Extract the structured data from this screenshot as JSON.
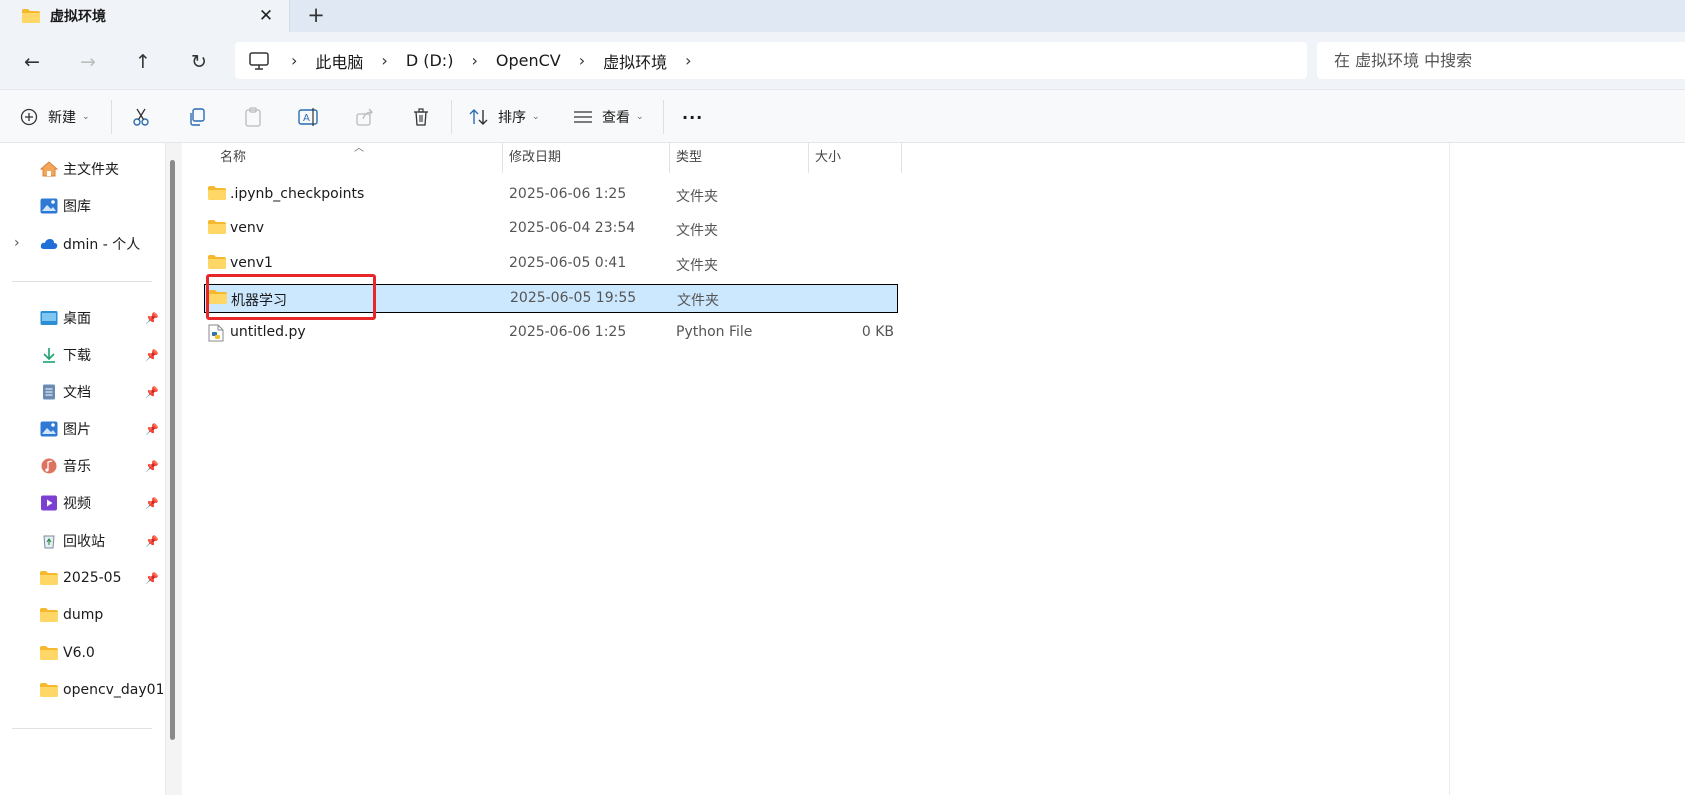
{
  "tab": {
    "title": "虚拟环境",
    "close": "✕",
    "add": "+"
  },
  "nav": {
    "back": "←",
    "forward": "→",
    "up": "↑",
    "refresh": "↻"
  },
  "breadcrumb": [
    "此电脑",
    "D (D:)",
    "OpenCV",
    "虚拟环境"
  ],
  "breadcrumb_sep": "›",
  "search": {
    "placeholder": "在 虚拟环境 中搜索"
  },
  "toolbar": {
    "new_label": "新建",
    "sort_label": "排序",
    "view_label": "查看",
    "more_label": "···",
    "caret": "⌄"
  },
  "sidebar": {
    "top_items": [
      {
        "label": "主文件夹",
        "icon": "home-icon"
      },
      {
        "label": "图库",
        "icon": "gallery-icon"
      },
      {
        "label": "dmin - 个人",
        "icon": "onedrive-icon"
      }
    ],
    "expand": "›",
    "pinned_items": [
      {
        "label": "桌面",
        "icon": "desktop-icon"
      },
      {
        "label": "下载",
        "icon": "download-icon"
      },
      {
        "label": "文档",
        "icon": "document-icon"
      },
      {
        "label": "图片",
        "icon": "pictures-icon"
      },
      {
        "label": "音乐",
        "icon": "music-icon"
      },
      {
        "label": "视频",
        "icon": "video-icon"
      },
      {
        "label": "回收站",
        "icon": "recycle-bin-icon"
      },
      {
        "label": "2025-05",
        "icon": "folder-icon"
      }
    ],
    "folder_items": [
      {
        "label": "dump",
        "icon": "folder-icon"
      },
      {
        "label": "V6.0",
        "icon": "folder-icon"
      },
      {
        "label": "opencv_day01",
        "icon": "folder-icon"
      }
    ],
    "pin_glyph": "📌"
  },
  "columns": {
    "name": "名称",
    "modified": "修改日期",
    "type": "类型",
    "size": "大小"
  },
  "files": [
    {
      "name": ".ipynb_checkpoints",
      "modified": "2025-06-06 1:25",
      "type": "文件夹",
      "size": "",
      "icon": "folder-icon"
    },
    {
      "name": "venv",
      "modified": "2025-06-04 23:54",
      "type": "文件夹",
      "size": "",
      "icon": "folder-icon"
    },
    {
      "name": "venv1",
      "modified": "2025-06-05 0:41",
      "type": "文件夹",
      "size": "",
      "icon": "folder-icon"
    },
    {
      "name": "机器学习",
      "modified": "2025-06-05 19:55",
      "type": "文件夹",
      "size": "",
      "icon": "folder-icon"
    },
    {
      "name": "untitled.py",
      "modified": "2025-06-06 1:25",
      "type": "Python File",
      "size": "0 KB",
      "icon": "python-file-icon"
    }
  ],
  "selected_file": "机器学习",
  "colors": {
    "accent_selected": "#cce8ff",
    "folder": "#f7c948",
    "annotation": "#e8272a"
  }
}
